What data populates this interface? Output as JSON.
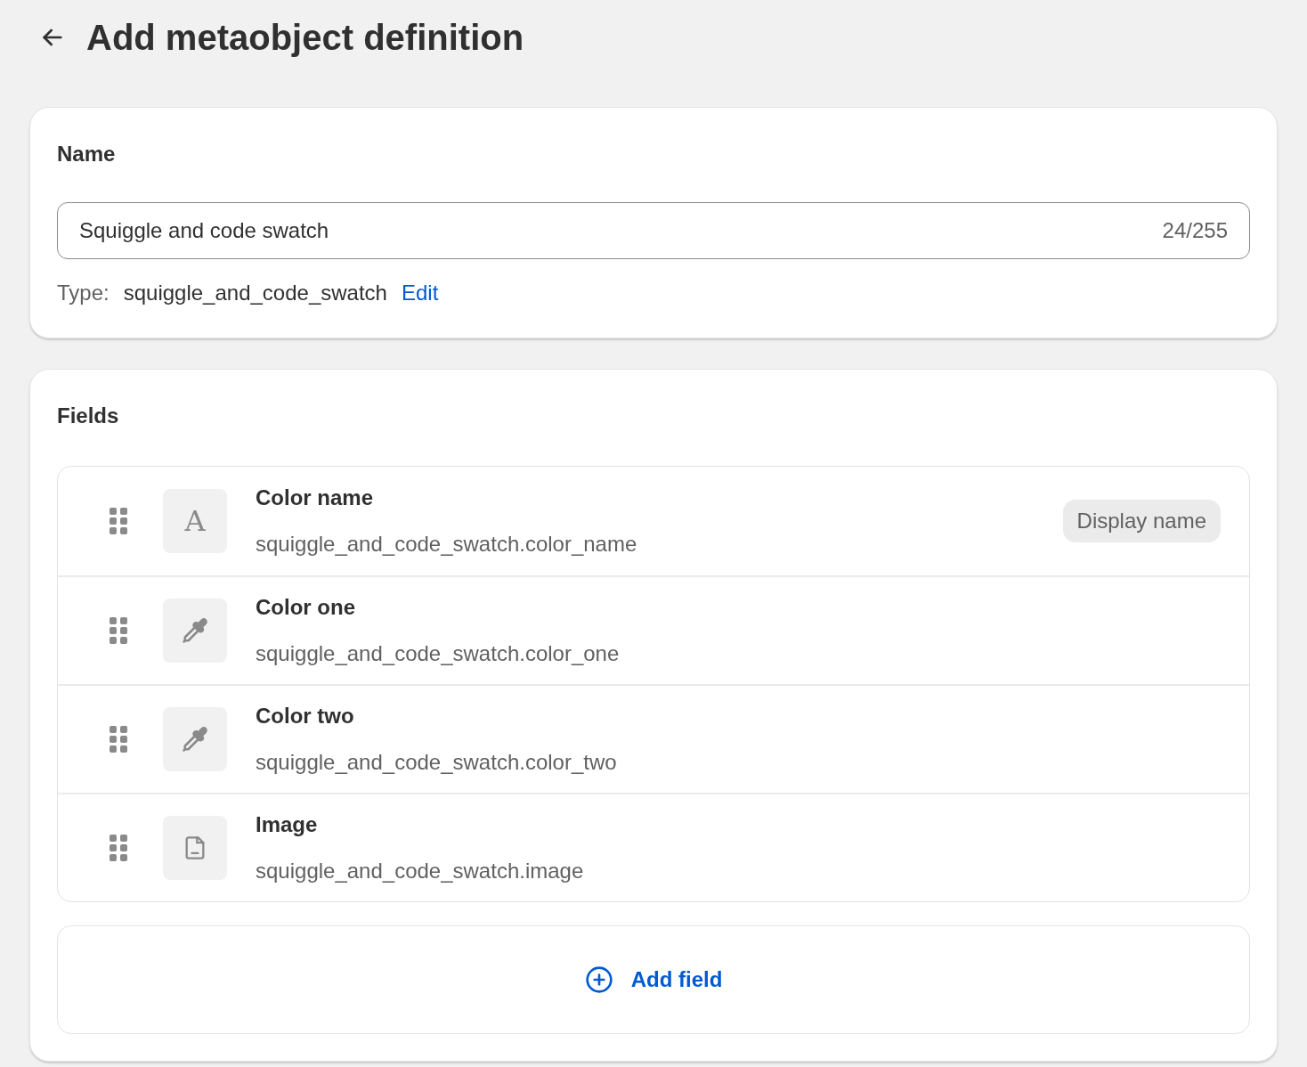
{
  "page_title": "Add metaobject definition",
  "name_card": {
    "label": "Name",
    "input_value": "Squiggle and code swatch",
    "char_count": "24/255",
    "type_label": "Type:",
    "type_value": "squiggle_and_code_swatch",
    "edit_link": "Edit"
  },
  "fields_card": {
    "label": "Fields",
    "fields": [
      {
        "kind": "text",
        "icon_text": "A",
        "name": "Color name",
        "key": "squiggle_and_code_swatch.color_name",
        "badge": "Display name"
      },
      {
        "kind": "color",
        "name": "Color one",
        "key": "squiggle_and_code_swatch.color_one"
      },
      {
        "kind": "color",
        "name": "Color two",
        "key": "squiggle_and_code_swatch.color_two"
      },
      {
        "kind": "file",
        "name": "Image",
        "key": "squiggle_and_code_swatch.image"
      }
    ],
    "add_button": "Add field"
  }
}
